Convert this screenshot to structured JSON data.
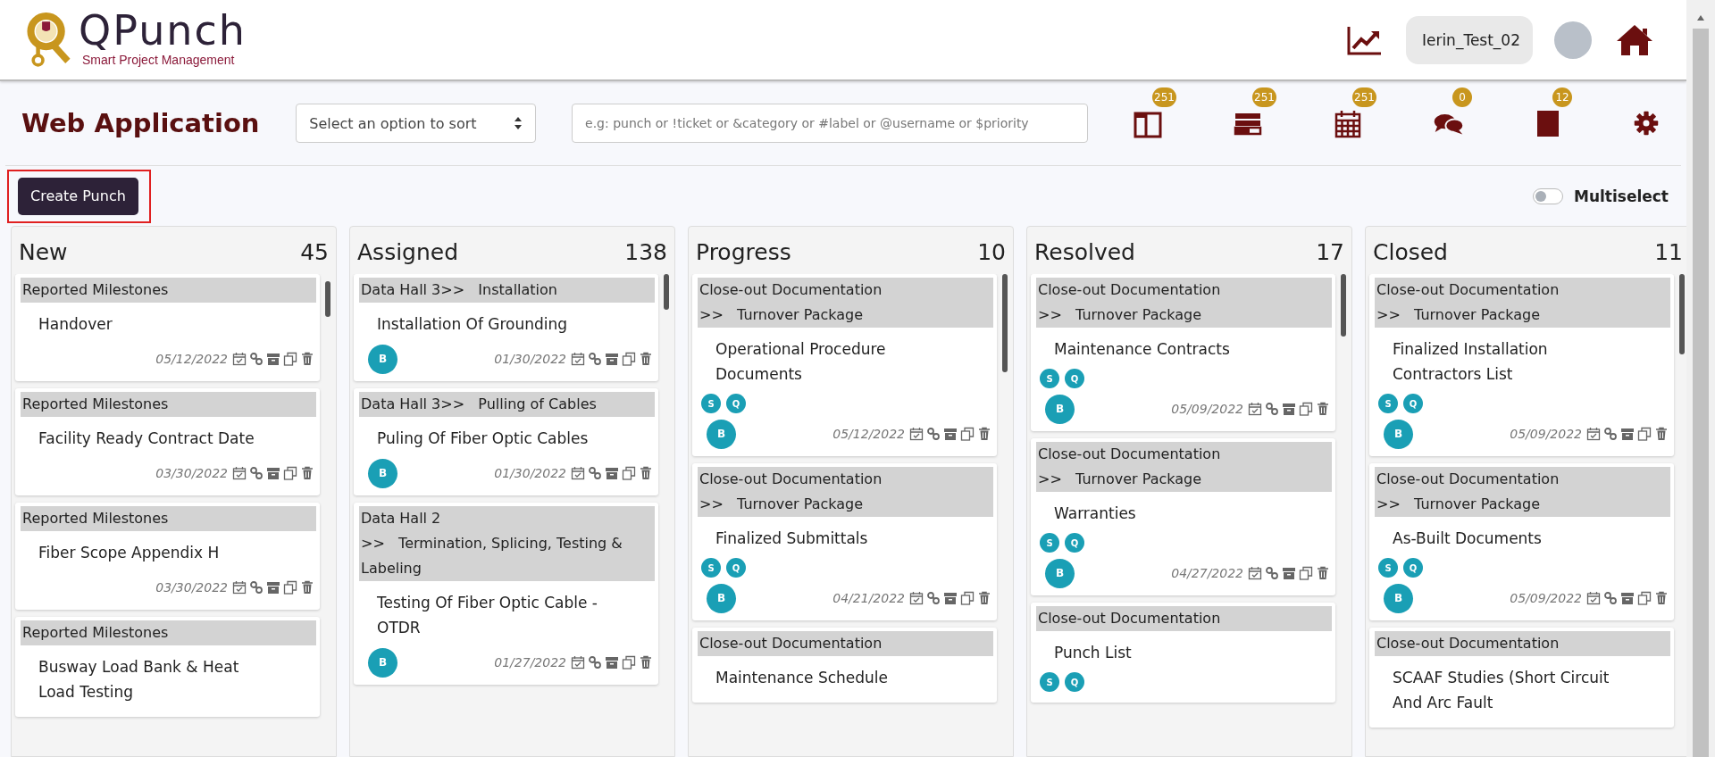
{
  "header": {
    "logo": {
      "name": "QPunch",
      "tagline": "Smart Project Management"
    },
    "user": "Ierin_Test_02"
  },
  "toolbar": {
    "title": "Web Application",
    "sort": {
      "placeholder": "Select an option to sort"
    },
    "search": {
      "placeholder": "e.g: punch or !ticket or &category or #label or @username or $priority"
    },
    "counters": [
      {
        "kind": "board",
        "count": "251"
      },
      {
        "kind": "list",
        "count": "251"
      },
      {
        "kind": "calendar",
        "count": "251"
      },
      {
        "kind": "chat",
        "count": "0"
      },
      {
        "kind": "note",
        "count": "12"
      },
      {
        "kind": "settings"
      }
    ]
  },
  "create_button": {
    "label": "Create Punch",
    "highlighted": true
  },
  "multiselect": {
    "label": "Multiselect",
    "on": false
  },
  "columns": [
    {
      "title": "New",
      "count": "45",
      "cards": [
        {
          "category": "Reported Milestones",
          "title": "Handover",
          "date": "05/12/2022"
        },
        {
          "category": "Reported Milestones",
          "title": "Facility Ready Contract Date",
          "date": "03/30/2022"
        },
        {
          "category": "Reported Milestones",
          "title": "Fiber Scope Appendix H",
          "date": "03/30/2022"
        },
        {
          "category": "Reported Milestones",
          "title": "Busway Load Bank & Heat Load Testing"
        }
      ]
    },
    {
      "title": "Assigned",
      "count": "138",
      "cards": [
        {
          "category": "Data Hall 3",
          "subcategory": ">>   Installation",
          "title": "Installation Of Grounding",
          "assignee": "B",
          "date": "01/30/2022"
        },
        {
          "category": "Data Hall 3",
          "subcategory": ">>   Pulling of Cables",
          "title": "Puling Of Fiber Optic Cables",
          "assignee": "B",
          "date": "01/30/2022"
        },
        {
          "category": "Data Hall 2",
          "subcategory": ">>   Termination, Splicing, Testing & Labeling",
          "title": "Testing Of Fiber Optic Cable - OTDR",
          "assignee": "B",
          "date": "01/27/2022"
        }
      ]
    },
    {
      "title": "Progress",
      "count": "10",
      "cards": [
        {
          "category": "Close-out Documentation",
          "subcategory": ">>   Turnover Package",
          "title": "Operational Procedure Documents",
          "tags": [
            "S",
            "Q"
          ],
          "assignee": "B",
          "date": "05/12/2022"
        },
        {
          "category": "Close-out Documentation",
          "subcategory": ">>   Turnover Package",
          "title": "Finalized Submittals",
          "tags": [
            "S",
            "Q"
          ],
          "assignee": "B",
          "date": "04/21/2022"
        },
        {
          "category": "Close-out Documentation",
          "title": "Maintenance Schedule"
        }
      ]
    },
    {
      "title": "Resolved",
      "count": "17",
      "cards": [
        {
          "category": "Close-out Documentation",
          "subcategory": ">>   Turnover Package",
          "title": "Maintenance Contracts",
          "tags": [
            "S",
            "Q"
          ],
          "assignee": "B",
          "date": "05/09/2022"
        },
        {
          "category": "Close-out Documentation",
          "subcategory": ">>   Turnover Package",
          "title": "Warranties",
          "tags": [
            "S",
            "Q"
          ],
          "assignee": "B",
          "date": "04/27/2022"
        },
        {
          "category": "Close-out Documentation",
          "title": "Punch List",
          "tags": [
            "S",
            "Q"
          ]
        }
      ]
    },
    {
      "title": "Closed",
      "count": "11",
      "cards": [
        {
          "category": "Close-out Documentation",
          "subcategory": ">>   Turnover Package",
          "title": "Finalized Installation Contractors List",
          "tags": [
            "S",
            "Q"
          ],
          "assignee": "B",
          "date": "05/09/2022"
        },
        {
          "category": "Close-out Documentation",
          "subcategory": ">>   Turnover Package",
          "title": "As-Built Documents",
          "tags": [
            "S",
            "Q"
          ],
          "assignee": "B",
          "date": "05/09/2022"
        },
        {
          "category": "Close-out Documentation",
          "title": "SCAAF Studies (Short Circuit And Arc Fault"
        }
      ]
    }
  ]
}
